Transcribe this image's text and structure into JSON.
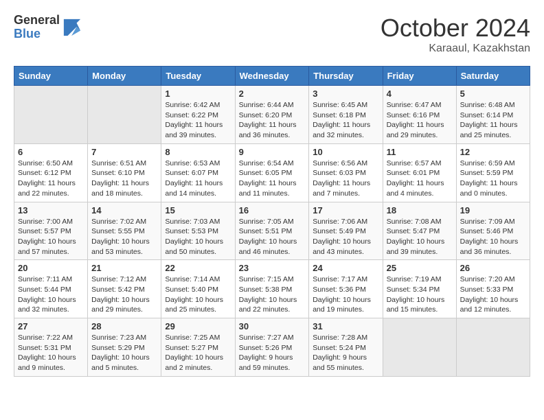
{
  "logo": {
    "general": "General",
    "blue": "Blue"
  },
  "title": "October 2024",
  "subtitle": "Karaaul, Kazakhstan",
  "days_of_week": [
    "Sunday",
    "Monday",
    "Tuesday",
    "Wednesday",
    "Thursday",
    "Friday",
    "Saturday"
  ],
  "weeks": [
    [
      {
        "day": "",
        "info": ""
      },
      {
        "day": "",
        "info": ""
      },
      {
        "day": "1",
        "sunrise": "6:42 AM",
        "sunset": "6:22 PM",
        "daylight": "11 hours and 39 minutes."
      },
      {
        "day": "2",
        "sunrise": "6:44 AM",
        "sunset": "6:20 PM",
        "daylight": "11 hours and 36 minutes."
      },
      {
        "day": "3",
        "sunrise": "6:45 AM",
        "sunset": "6:18 PM",
        "daylight": "11 hours and 32 minutes."
      },
      {
        "day": "4",
        "sunrise": "6:47 AM",
        "sunset": "6:16 PM",
        "daylight": "11 hours and 29 minutes."
      },
      {
        "day": "5",
        "sunrise": "6:48 AM",
        "sunset": "6:14 PM",
        "daylight": "11 hours and 25 minutes."
      }
    ],
    [
      {
        "day": "6",
        "sunrise": "6:50 AM",
        "sunset": "6:12 PM",
        "daylight": "11 hours and 22 minutes."
      },
      {
        "day": "7",
        "sunrise": "6:51 AM",
        "sunset": "6:10 PM",
        "daylight": "11 hours and 18 minutes."
      },
      {
        "day": "8",
        "sunrise": "6:53 AM",
        "sunset": "6:07 PM",
        "daylight": "11 hours and 14 minutes."
      },
      {
        "day": "9",
        "sunrise": "6:54 AM",
        "sunset": "6:05 PM",
        "daylight": "11 hours and 11 minutes."
      },
      {
        "day": "10",
        "sunrise": "6:56 AM",
        "sunset": "6:03 PM",
        "daylight": "11 hours and 7 minutes."
      },
      {
        "day": "11",
        "sunrise": "6:57 AM",
        "sunset": "6:01 PM",
        "daylight": "11 hours and 4 minutes."
      },
      {
        "day": "12",
        "sunrise": "6:59 AM",
        "sunset": "5:59 PM",
        "daylight": "11 hours and 0 minutes."
      }
    ],
    [
      {
        "day": "13",
        "sunrise": "7:00 AM",
        "sunset": "5:57 PM",
        "daylight": "10 hours and 57 minutes."
      },
      {
        "day": "14",
        "sunrise": "7:02 AM",
        "sunset": "5:55 PM",
        "daylight": "10 hours and 53 minutes."
      },
      {
        "day": "15",
        "sunrise": "7:03 AM",
        "sunset": "5:53 PM",
        "daylight": "10 hours and 50 minutes."
      },
      {
        "day": "16",
        "sunrise": "7:05 AM",
        "sunset": "5:51 PM",
        "daylight": "10 hours and 46 minutes."
      },
      {
        "day": "17",
        "sunrise": "7:06 AM",
        "sunset": "5:49 PM",
        "daylight": "10 hours and 43 minutes."
      },
      {
        "day": "18",
        "sunrise": "7:08 AM",
        "sunset": "5:47 PM",
        "daylight": "10 hours and 39 minutes."
      },
      {
        "day": "19",
        "sunrise": "7:09 AM",
        "sunset": "5:46 PM",
        "daylight": "10 hours and 36 minutes."
      }
    ],
    [
      {
        "day": "20",
        "sunrise": "7:11 AM",
        "sunset": "5:44 PM",
        "daylight": "10 hours and 32 minutes."
      },
      {
        "day": "21",
        "sunrise": "7:12 AM",
        "sunset": "5:42 PM",
        "daylight": "10 hours and 29 minutes."
      },
      {
        "day": "22",
        "sunrise": "7:14 AM",
        "sunset": "5:40 PM",
        "daylight": "10 hours and 25 minutes."
      },
      {
        "day": "23",
        "sunrise": "7:15 AM",
        "sunset": "5:38 PM",
        "daylight": "10 hours and 22 minutes."
      },
      {
        "day": "24",
        "sunrise": "7:17 AM",
        "sunset": "5:36 PM",
        "daylight": "10 hours and 19 minutes."
      },
      {
        "day": "25",
        "sunrise": "7:19 AM",
        "sunset": "5:34 PM",
        "daylight": "10 hours and 15 minutes."
      },
      {
        "day": "26",
        "sunrise": "7:20 AM",
        "sunset": "5:33 PM",
        "daylight": "10 hours and 12 minutes."
      }
    ],
    [
      {
        "day": "27",
        "sunrise": "7:22 AM",
        "sunset": "5:31 PM",
        "daylight": "10 hours and 9 minutes."
      },
      {
        "day": "28",
        "sunrise": "7:23 AM",
        "sunset": "5:29 PM",
        "daylight": "10 hours and 5 minutes."
      },
      {
        "day": "29",
        "sunrise": "7:25 AM",
        "sunset": "5:27 PM",
        "daylight": "10 hours and 2 minutes."
      },
      {
        "day": "30",
        "sunrise": "7:27 AM",
        "sunset": "5:26 PM",
        "daylight": "9 hours and 59 minutes."
      },
      {
        "day": "31",
        "sunrise": "7:28 AM",
        "sunset": "5:24 PM",
        "daylight": "9 hours and 55 minutes."
      },
      {
        "day": "",
        "info": ""
      },
      {
        "day": "",
        "info": ""
      }
    ]
  ],
  "labels": {
    "sunrise": "Sunrise:",
    "sunset": "Sunset:",
    "daylight": "Daylight:"
  }
}
